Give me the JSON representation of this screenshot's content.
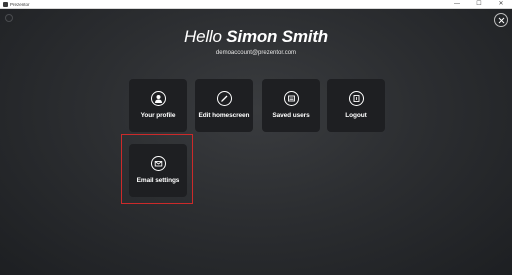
{
  "window": {
    "title": "Prezentor",
    "minimize_glyph": "—",
    "maximize_glyph": "☐",
    "close_glyph": "✕"
  },
  "header": {
    "hello": "Hello",
    "user_name": "Simon Smith",
    "email": "demoaccount@prezentor.com"
  },
  "menu": {
    "your_profile": {
      "label": "Your profile",
      "icon": "user-icon"
    },
    "edit_homescreen": {
      "label": "Edit homescreen",
      "icon": "pencil-icon"
    },
    "saved_users": {
      "label": "Saved users",
      "icon": "saved-users-icon"
    },
    "logout": {
      "label": "Logout",
      "icon": "logout-icon"
    },
    "email_settings": {
      "label": "Email settings",
      "icon": "envelope-icon"
    }
  },
  "colors": {
    "background": "#2a2b2d",
    "tile": "#1e1f22",
    "text": "#ffffff",
    "highlight": "#cc2a2a"
  }
}
